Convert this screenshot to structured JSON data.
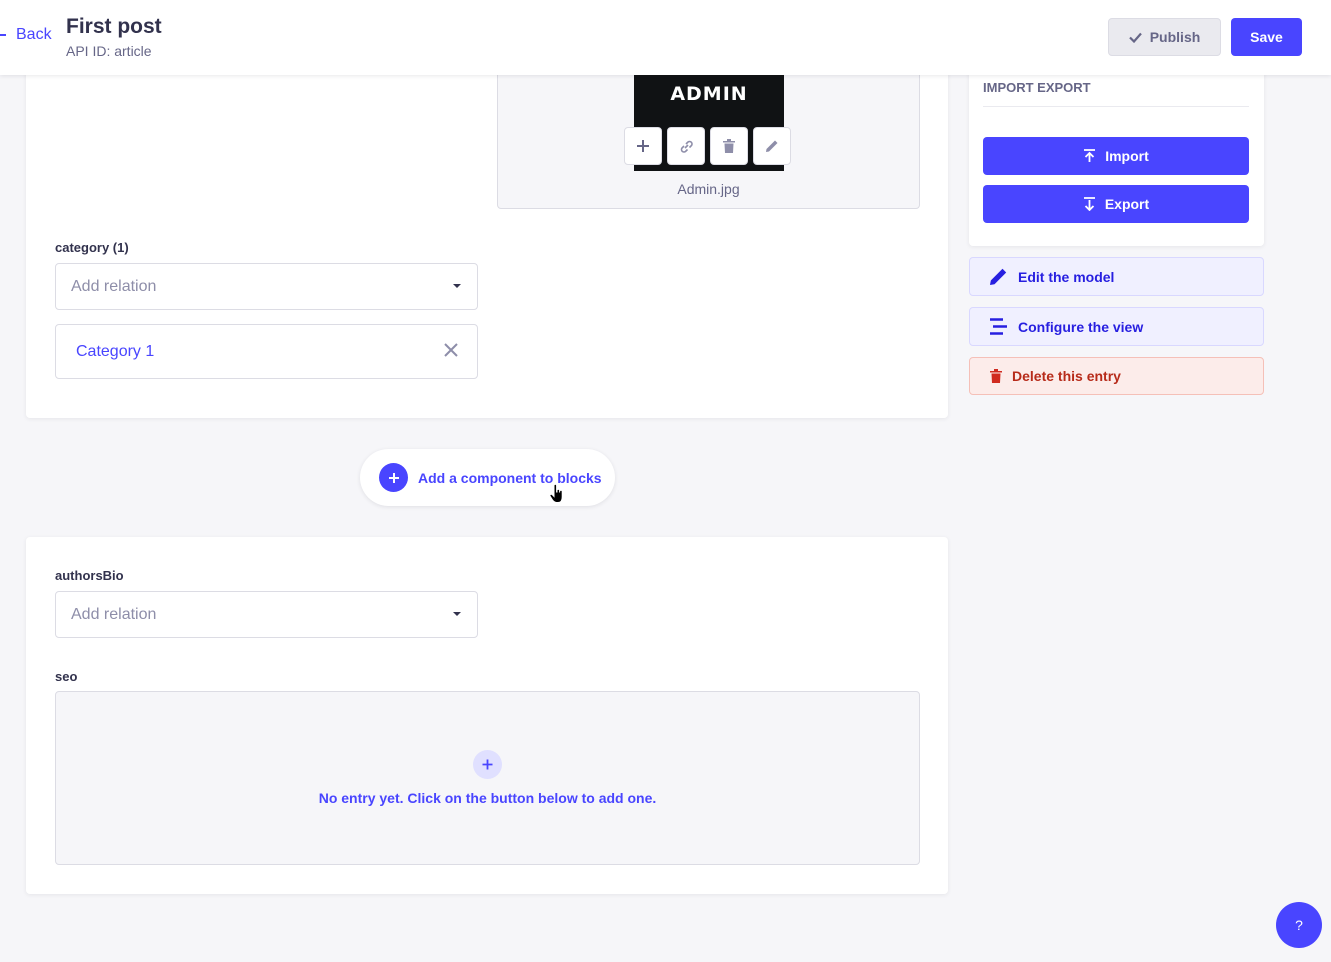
{
  "header": {
    "back_label": "Back",
    "title": "First post",
    "api_id": "API ID: article",
    "publish_label": "Publish",
    "save_label": "Save"
  },
  "media": {
    "image_text": "ADMIN",
    "filename": "Admin.jpg",
    "actions": [
      "plus-icon",
      "link-icon",
      "trash-icon",
      "pencil-icon"
    ]
  },
  "category": {
    "label": "category (1)",
    "placeholder": "Add relation",
    "selected": "Category 1"
  },
  "blocks": {
    "add_label": "Add a component to blocks"
  },
  "authorsBio": {
    "label": "authorsBio",
    "placeholder": "Add relation"
  },
  "seo": {
    "label": "seo",
    "empty_text": "No entry yet. Click on the button below to add one."
  },
  "sidebar": {
    "section_title": "IMPORT EXPORT",
    "import_label": "Import",
    "export_label": "Export",
    "edit_model_label": "Edit the model",
    "configure_view_label": "Configure the view",
    "delete_label": "Delete this entry"
  },
  "help": {
    "label": "?"
  },
  "colors": {
    "primary": "#4945ff",
    "danger": "#b72b1a",
    "background": "#f6f6f9"
  }
}
